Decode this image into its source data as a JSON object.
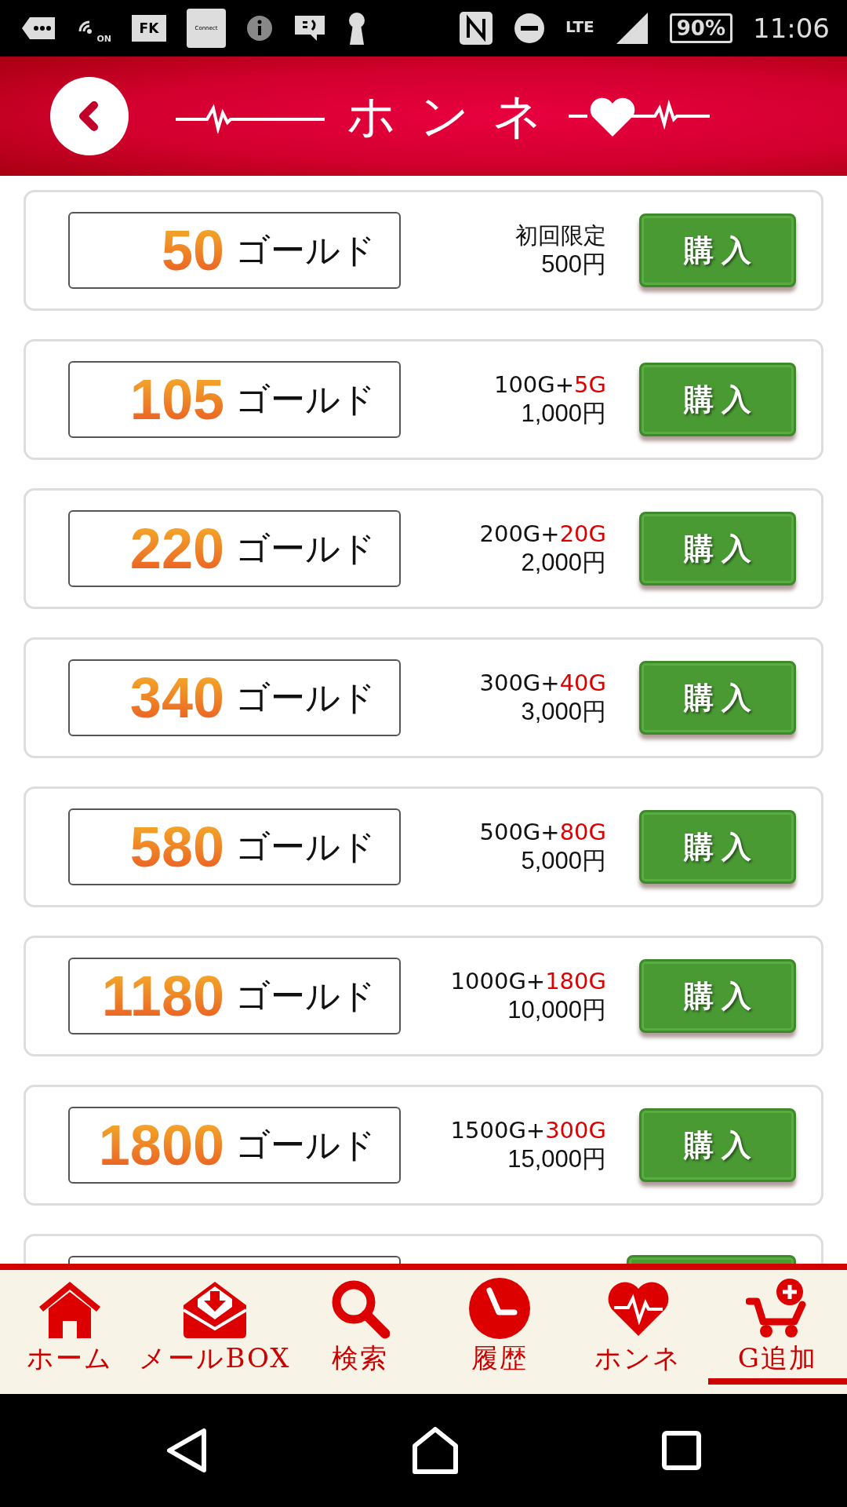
{
  "status_bar": {
    "wifi_label": "ON",
    "app_label": "FK",
    "connect_label": "Connect",
    "network": "LTE",
    "battery": "90%",
    "time": "11:06"
  },
  "header": {
    "title": "ホンネ"
  },
  "packs": [
    {
      "kind": "pack",
      "amount": "50",
      "unit": "ゴールド",
      "note": "初回限定",
      "price": "500円",
      "button": "購入"
    },
    {
      "kind": "pack",
      "amount": "105",
      "unit": "ゴールド",
      "note": "100G+",
      "bonus": "5G",
      "price": "1,000円",
      "button": "購入"
    },
    {
      "kind": "pack",
      "amount": "220",
      "unit": "ゴールド",
      "note": "200G+",
      "bonus": "20G",
      "price": "2,000円",
      "button": "購入"
    },
    {
      "kind": "pack",
      "amount": "340",
      "unit": "ゴールド",
      "note": "300G+",
      "bonus": "40G",
      "price": "3,000円",
      "button": "購入"
    },
    {
      "kind": "pack",
      "amount": "580",
      "unit": "ゴールド",
      "note": "500G+",
      "bonus": "80G",
      "price": "5,000円",
      "button": "購入"
    },
    {
      "kind": "pack",
      "amount": "1180",
      "unit": "ゴールド",
      "note": "1000G+",
      "bonus": "180G",
      "price": "10,000円",
      "button": "購入"
    },
    {
      "kind": "pack",
      "amount": "1800",
      "unit": "ゴールド",
      "note": "1500G+",
      "bonus": "300G",
      "price": "15,000円",
      "button": "購入"
    },
    {
      "kind": "cut"
    }
  ],
  "tab_bar": [
    {
      "kind": "home",
      "label": "ホーム",
      "selected": false
    },
    {
      "kind": "mail",
      "label": "メールBOX",
      "selected": false
    },
    {
      "kind": "search",
      "label": "検索",
      "selected": false
    },
    {
      "kind": "history",
      "label": "履歴",
      "selected": false
    },
    {
      "kind": "honne",
      "label": "ホンネ",
      "selected": false
    },
    {
      "kind": "cart",
      "label": "G追加",
      "selected": true
    }
  ]
}
